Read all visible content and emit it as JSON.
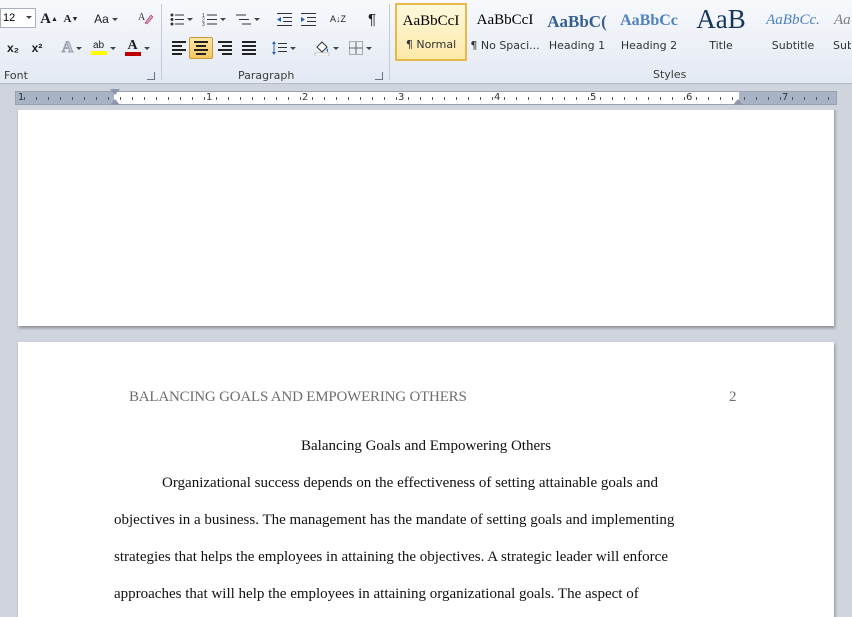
{
  "ribbon": {
    "font_group": {
      "label": "Font",
      "font_size": "12",
      "grow_font": "A",
      "shrink_font": "A",
      "change_case": "Aa",
      "subscript": "x₂",
      "superscript": "x²",
      "text_effects": "A",
      "highlight": "ab",
      "font_color": "A",
      "font_color_value": "#c00000",
      "highlight_color_value": "#ffff00"
    },
    "paragraph_group": {
      "label": "Paragraph",
      "show_marks": "¶",
      "sort": "A↓Z"
    },
    "styles_group": {
      "label": "Styles",
      "items": [
        {
          "sample": "AaBbCcI",
          "name": "¶ Normal"
        },
        {
          "sample": "AaBbCcI",
          "name": "¶ No Spaci..."
        },
        {
          "sample": "AaBbC(",
          "name": "Heading 1"
        },
        {
          "sample": "AaBbCc",
          "name": "Heading 2"
        },
        {
          "sample": "AaB",
          "name": "Title"
        },
        {
          "sample": "AaBbCc.",
          "name": "Subtitle"
        },
        {
          "sample": "Aa",
          "name": "Sub"
        }
      ]
    }
  },
  "ruler": {
    "numbers": [
      "1",
      "1",
      "2",
      "3",
      "4",
      "5",
      "6",
      "7"
    ]
  },
  "document": {
    "running_head": "BALANCING GOALS AND EMPOWERING OTHERS",
    "page_number": "2",
    "title": "Balancing Goals and Empowering Others",
    "lines": [
      "Organizational success depends on the effectiveness of setting attainable goals and",
      "objectives in a business. The management has the mandate of setting goals and implementing",
      "strategies that helps the employees in attaining the objectives. A strategic leader will enforce",
      "approaches that will help the employees in attaining organizational goals. The aspect of"
    ]
  },
  "colors": {
    "accent": "#f7c75d",
    "heading_blue": "#365f91",
    "title_blue": "#17365d"
  }
}
